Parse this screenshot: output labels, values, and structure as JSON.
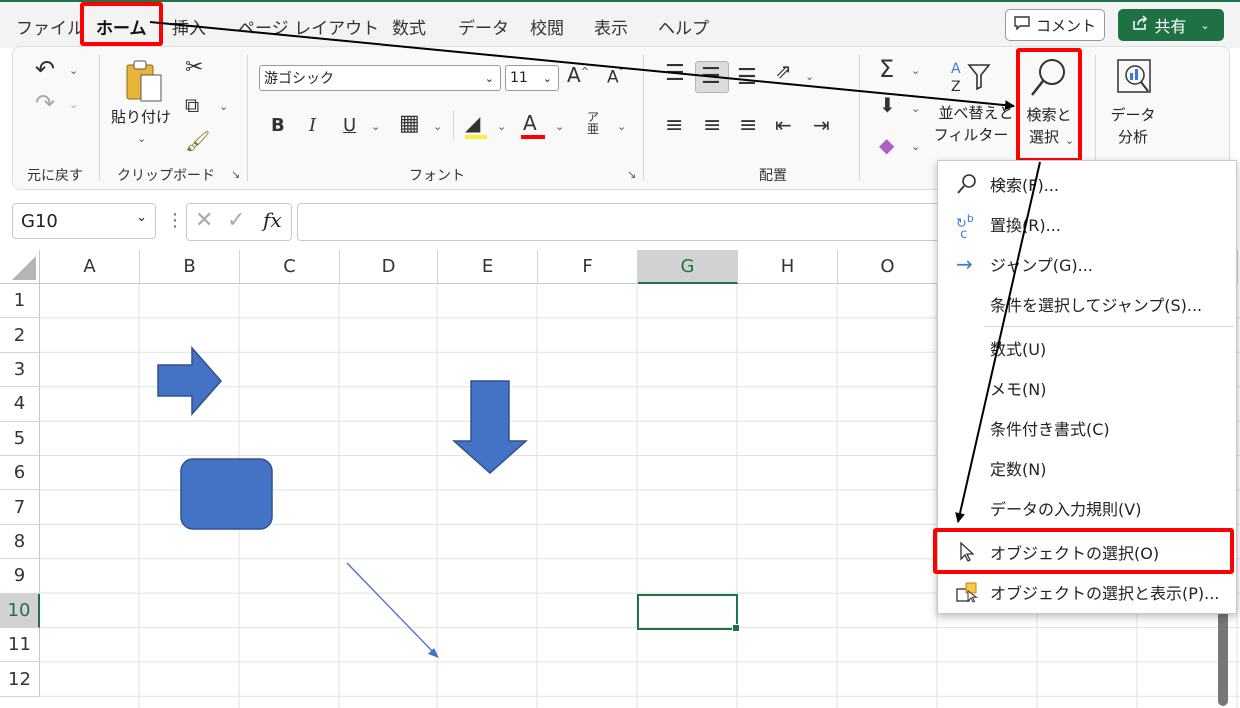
{
  "tabs": [
    "ファイル",
    "ホーム",
    "挿入",
    "ページ レイアウト",
    "数式",
    "データ",
    "校閲",
    "表示",
    "ヘルプ"
  ],
  "comment_label": "コメント",
  "share_label": "共有",
  "ribbon": {
    "undo_group_label": "元に戻す",
    "clipboard": {
      "paste_label": "貼り付け",
      "group_label": "クリップボード"
    },
    "font": {
      "font_name": "游ゴシック",
      "font_size": "11",
      "group_label": "フォント",
      "bold": "B",
      "italic": "I",
      "underline": "U",
      "font_color_glyph": "A"
    },
    "alignment": {
      "group_label": "配置"
    },
    "editing": {
      "sort_filter_line1": "並べ替えと",
      "sort_filter_line2": "フィルター",
      "find_select_line1": "検索と",
      "find_select_line2": "選択",
      "data_analysis_line1": "データ",
      "data_analysis_line2": "分析"
    }
  },
  "formula_bar": {
    "name_box": "G10",
    "fx": "fx",
    "value": ""
  },
  "columns": [
    "A",
    "B",
    "C",
    "D",
    "E",
    "F",
    "G",
    "H",
    "O"
  ],
  "rows": [
    "1",
    "2",
    "3",
    "4",
    "5",
    "6",
    "7",
    "8",
    "9",
    "10",
    "11",
    "12"
  ],
  "selected_cell": {
    "column": "G",
    "row": "10"
  },
  "dropdown_items": [
    {
      "label": "検索(F)...",
      "icon": "search-icon"
    },
    {
      "label": "置換(R)...",
      "icon": "replace-icon"
    },
    {
      "label": "ジャンプ(G)...",
      "icon": "arrow-right-icon"
    },
    {
      "label": "条件を選択してジャンプ(S)...",
      "icon": ""
    },
    {
      "label": "数式(U)",
      "icon": ""
    },
    {
      "label": "メモ(N)",
      "icon": ""
    },
    {
      "label": "条件付き書式(C)",
      "icon": ""
    },
    {
      "label": "定数(N)",
      "icon": ""
    },
    {
      "label": "データの入力規則(V)",
      "icon": ""
    },
    {
      "label": "オブジェクトの選択(O)",
      "icon": "cursor-icon"
    },
    {
      "label": "オブジェクトの選択と表示(P)...",
      "icon": "selection-pane-icon"
    }
  ],
  "colors": {
    "accent": "#217346",
    "highlight": "#ff0000",
    "shape_fill": "#4472c4",
    "shape_stroke": "#2f528f"
  }
}
